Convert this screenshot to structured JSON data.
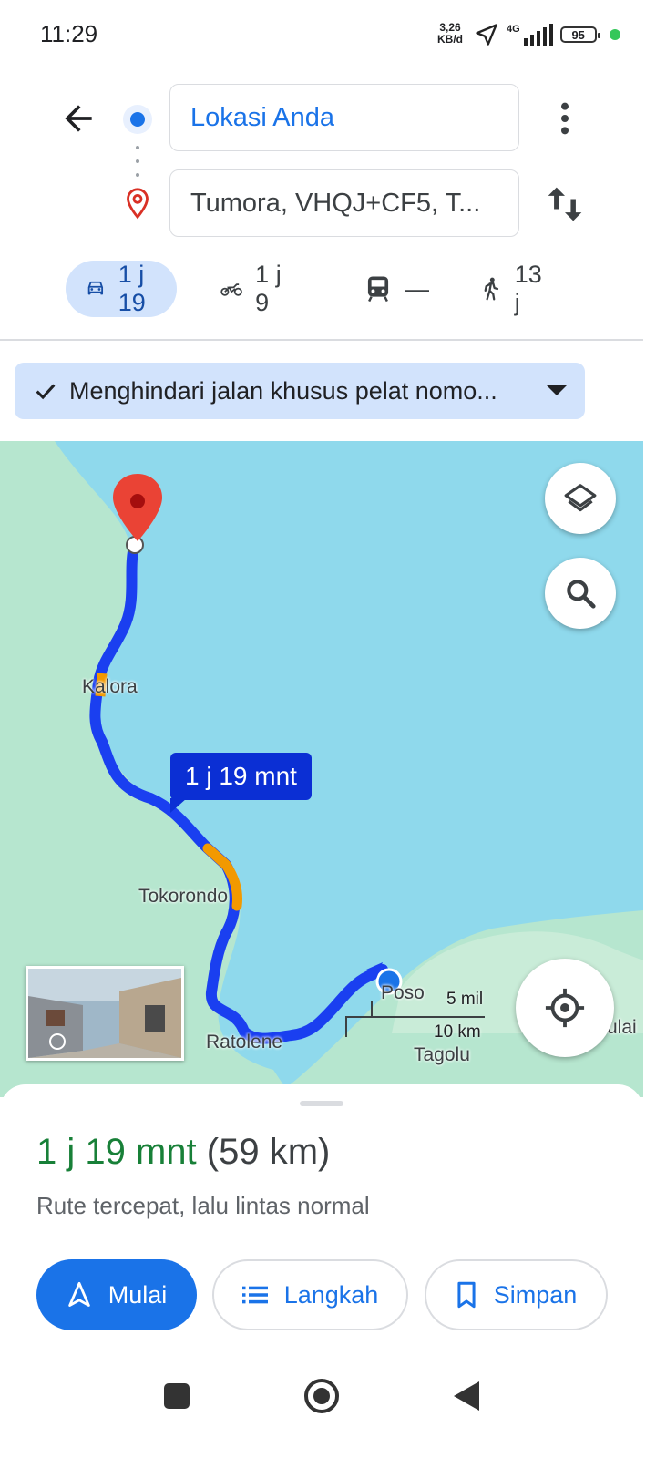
{
  "status_bar": {
    "time": "11:29",
    "net_speed_value": "3,26",
    "net_speed_unit": "KB/d",
    "network": "4G",
    "battery": "95"
  },
  "search": {
    "origin": "Lokasi Anda",
    "destination": "Tumora, VHQJ+CF5, T..."
  },
  "modes": [
    {
      "name": "car-icon",
      "label": "1 j 19",
      "active": true
    },
    {
      "name": "motorcycle-icon",
      "label": "1 j 9"
    },
    {
      "name": "transit-icon",
      "label": "—"
    },
    {
      "name": "walk-icon",
      "label": "13 j"
    }
  ],
  "filter_chip": {
    "label": "Menghindari jalan khusus pelat nomo..."
  },
  "map": {
    "route_badge": "1 j 19 mnt",
    "labels": {
      "kalora": "Kalora",
      "tokorondo": "Tokorondo",
      "ratolene": "Ratolene",
      "poso": "Poso",
      "tagolu": "Tagolu",
      "ulai": "ulai"
    },
    "scale_mi": "5 mil",
    "scale_km": "10 km",
    "colors": {
      "water": "#8fd9ec",
      "land": "#b6e6cf",
      "route": "#1a3ff0",
      "traffic": "#f29900"
    }
  },
  "sheet": {
    "duration": "1 j 19 mnt",
    "distance": "(59 km)",
    "description": "Rute tercepat, lalu lintas normal",
    "buttons": {
      "start": "Mulai",
      "steps": "Langkah",
      "save": "Simpan"
    }
  }
}
